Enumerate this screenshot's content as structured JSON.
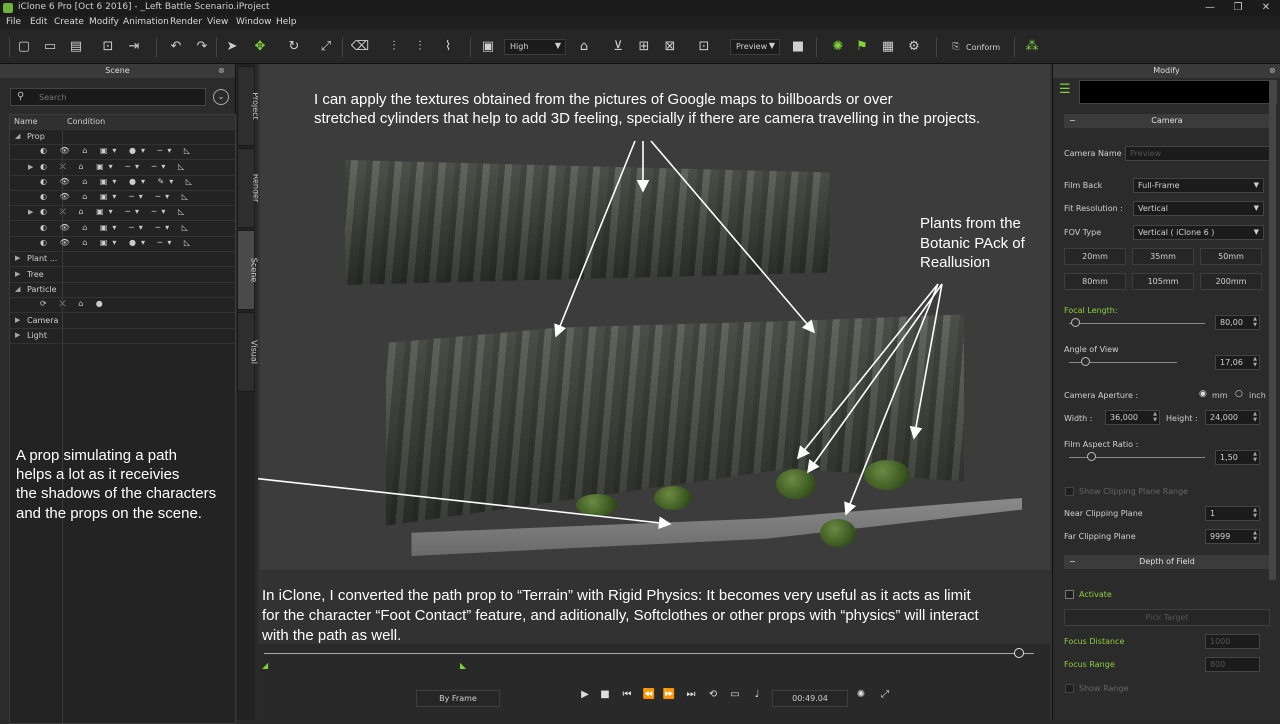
{
  "window": {
    "title": "iClone 6 Pro [Oct  6 2016] - _Left Battle Scenario.iProject",
    "minimize": "—",
    "maximize": "❐",
    "close": "✕"
  },
  "menu": [
    "File",
    "Edit",
    "Create",
    "Modify",
    "Animation",
    "Render",
    "View",
    "Window",
    "Help"
  ],
  "toolbar": {
    "quality": "High",
    "preview": "Preview",
    "conform": "Conform"
  },
  "scene_panel": {
    "title": "Scene",
    "search_placeholder": "Search",
    "col_name": "Name",
    "col_condition": "Condition",
    "rows": [
      {
        "label": "Prop",
        "expanded": true
      },
      {
        "label": "",
        "icons": "◐ 👁 ⌂ ▣▾ ●▾ ─▾ ◺"
      },
      {
        "label": "",
        "icons": "◐ ⤫ ⌂ ▣▾ ─▾ ─▾ ◺"
      },
      {
        "label": "",
        "icons": "◐ 👁 ⌂ ▣▾ ●▾ ✎▾ ◺"
      },
      {
        "label": "",
        "icons": "◐ 👁 ⌂ ▣▾ ─▾ ─▾ ◺"
      },
      {
        "label": "",
        "icons": "◐ ⤫ ⌂ ▣▾ ─▾ ─▾ ◺"
      },
      {
        "label": "",
        "icons": "◐ 👁 ⌂ ▣▾ ─▾ ─▾ ◺"
      },
      {
        "label": "",
        "icons": "◐ 👁 ⌂ ▣▾ ●▾ ─▾ ◺"
      },
      {
        "label": "Plant ...",
        "expanded": false
      },
      {
        "label": "Tree",
        "expanded": false
      },
      {
        "label": "Particle",
        "expanded": true
      },
      {
        "label": "",
        "icons": "⟳ ⤫ ⌂ ●"
      },
      {
        "label": "Camera",
        "expanded": false
      },
      {
        "label": "Light",
        "expanded": false
      }
    ]
  },
  "side_tabs": [
    "Project",
    "Render",
    "Scene",
    "Visual"
  ],
  "viewport": {
    "annotation_top_1": "I can apply the textures obtained from the pictures of Google maps to billboards or over",
    "annotation_top_2": "stretched cylinders that help to add 3D feeling, specially if there are camera travelling in the projects.",
    "annotation_plants_1": "Plants from the",
    "annotation_plants_2": "Botanic PAck of",
    "annotation_plants_3": "Reallusion",
    "annotation_left_1": "A prop simulating a path",
    "annotation_left_2": "helps a lot as it receivies",
    "annotation_left_3": "the shadows of the characters",
    "annotation_left_4": "and the props on the scene.",
    "annotation_bottom_1": "In iClone, I converted the path prop to “Terrain” with Rigid Physics:  It becomes very useful as it acts as limit",
    "annotation_bottom_2": "for the character “Foot Contact” feature, and aditionally, Softclothes or other props with “physics” will interact",
    "annotation_bottom_3": "with the path as well."
  },
  "playback": {
    "mode": "By Frame",
    "time": "00:49.04"
  },
  "modify_panel": {
    "title": "Modify",
    "section_camera": "Camera",
    "camera_name_label": "Camera Name :",
    "camera_name_value": "Preview",
    "film_back_label": "Film Back",
    "film_back_value": "Full-Frame",
    "fit_resolution_label": "Fit Resolution :",
    "fit_resolution_value": "Vertical",
    "fov_type_label": "FOV Type",
    "fov_type_value": "Vertical ( iClone 6 )",
    "lens_buttons": [
      "20mm",
      "35mm",
      "50mm",
      "80mm",
      "105mm",
      "200mm"
    ],
    "focal_length_label": "Focal Length:",
    "focal_length_value": "80,00",
    "angle_of_view_label": "Angle of View",
    "angle_of_view_value": "17,06",
    "aperture_label": "Camera Aperture :",
    "unit_mm": "mm",
    "unit_inch": "inch",
    "width_label": "Width :",
    "width_value": "36,000",
    "height_label": "Height :",
    "height_value": "24,000",
    "film_aspect_label": "Film Aspect Ratio :",
    "film_aspect_value": "1,50",
    "show_clipping_label": "Show Clipping Plane Range",
    "near_clip_label": "Near Clipping Plane",
    "near_clip_value": "1",
    "far_clip_label": "Far Clipping Plane",
    "far_clip_value": "9999",
    "section_dof": "Depth of Field",
    "activate_label": "Activate",
    "pick_target": "Pick Target",
    "focus_distance_label": "Focus Distance",
    "focus_distance_value": "1000",
    "focus_range_label": "Focus Range",
    "focus_range_value": "800",
    "show_range_label": "Show Range"
  }
}
